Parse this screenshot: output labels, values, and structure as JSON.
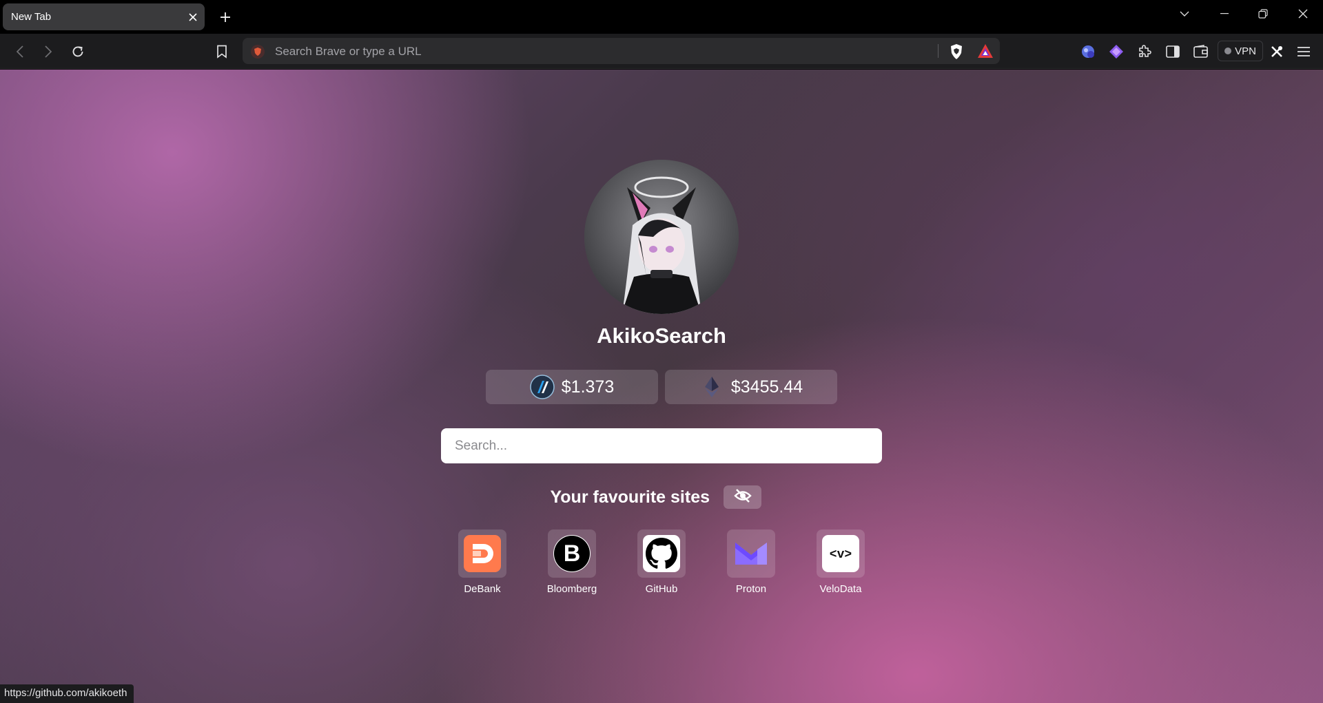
{
  "browser": {
    "tab": {
      "title": "New Tab"
    },
    "omnibox": {
      "placeholder": "Search Brave or type a URL"
    },
    "vpn_label": "VPN",
    "status_url": "https://github.com/akikoeth"
  },
  "page": {
    "brand_title": "AkikoSearch",
    "prices": [
      {
        "token_icon": "arbitrum-icon",
        "value": "$1.373"
      },
      {
        "token_icon": "ethereum-icon",
        "value": "$3455.44"
      }
    ],
    "search": {
      "placeholder": "Search..."
    },
    "favourites": {
      "heading": "Your favourite sites",
      "toggle_icon": "eye-off-icon",
      "sites": [
        {
          "label": "DeBank",
          "icon": "debank-icon",
          "color": "#ff7a4d"
        },
        {
          "label": "Bloomberg",
          "icon": "bloomberg-icon",
          "color": "#000000"
        },
        {
          "label": "GitHub",
          "icon": "github-icon",
          "color": "#ffffff"
        },
        {
          "label": "Proton",
          "icon": "proton-icon",
          "color": "#6d4aff"
        },
        {
          "label": "VeloData",
          "icon": "velodata-icon",
          "color": "#ffffff"
        }
      ]
    }
  },
  "colors": {
    "toolbar": "#1c1c1e",
    "omnibox": "#2c2c2e",
    "accent_pink": "#c4629e",
    "accent_violet": "#b469aa"
  }
}
